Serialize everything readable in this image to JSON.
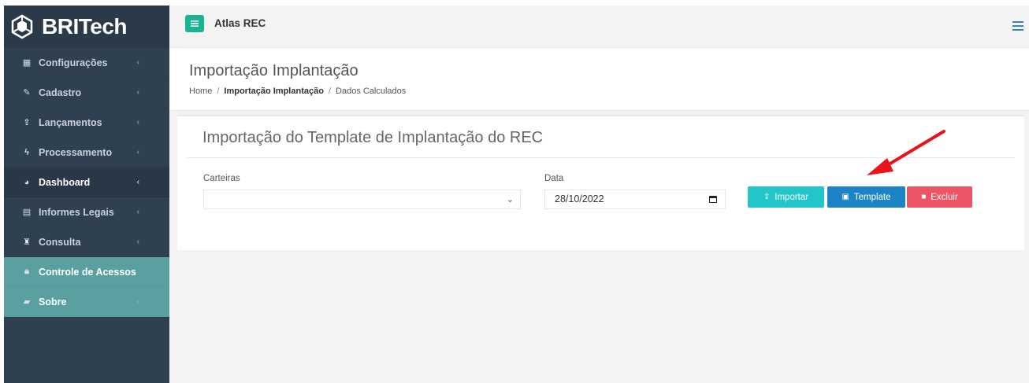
{
  "brand": {
    "name": "BRITech",
    "icon": "britech-logo-icon"
  },
  "sidebar": {
    "items": [
      {
        "label": "Configurações",
        "icon": "grid-icon",
        "state": "normal"
      },
      {
        "label": "Cadastro",
        "icon": "edit-icon",
        "state": "normal"
      },
      {
        "label": "Lançamentos",
        "icon": "upload-icon",
        "state": "normal"
      },
      {
        "label": "Processamento",
        "icon": "bolt-icon",
        "state": "normal"
      },
      {
        "label": "Dashboard",
        "icon": "pie-chart-icon",
        "state": "active"
      },
      {
        "label": "Informes Legais",
        "icon": "report-icon",
        "state": "normal"
      },
      {
        "label": "Consulta",
        "icon": "binoculars-icon",
        "state": "normal"
      },
      {
        "label": "Controle de Acessos",
        "icon": "lock-icon",
        "state": "green"
      },
      {
        "label": "Sobre",
        "icon": "book-icon",
        "state": "green"
      }
    ]
  },
  "topbar": {
    "app_title": "Atlas REC"
  },
  "header": {
    "title": "Importação Implantação",
    "breadcrumb": {
      "home": "Home",
      "sep": "/",
      "current": "Importação Implantação",
      "last": "Dados Calculados"
    }
  },
  "card": {
    "title": "Importação do Template de Implantação do REC",
    "carteiras_label": "Carteiras",
    "carteiras_value": "",
    "data_label": "Data",
    "data_value": "28/10/2022",
    "buttons": {
      "import": "Importar",
      "template": "Template",
      "delete": "Excluir"
    }
  },
  "colors": {
    "sidebar": "#2f4050",
    "green_accent": "#1ab394",
    "sidebar_green": "#5ba0a0",
    "import_btn": "#23c6c8",
    "template_btn": "#1c84c6",
    "delete_btn": "#ed5565",
    "annotation_arrow": "#e8141b"
  }
}
